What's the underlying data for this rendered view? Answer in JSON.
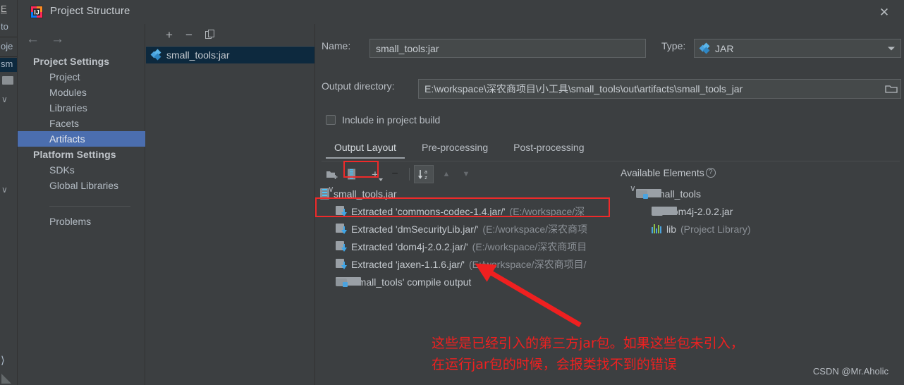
{
  "window": {
    "title": "Project Structure",
    "icon": "intellij-idea-icon",
    "close_label": "✕"
  },
  "background_ide": {
    "menu_fragment": "E",
    "fragments": [
      "to",
      "oje",
      "sm"
    ],
    "selected_fragment": "sm"
  },
  "nav": {
    "back_label": "←",
    "forward_label": "→"
  },
  "sidebar": {
    "groups": [
      {
        "header": "Project Settings",
        "items": [
          {
            "label": "Project",
            "selected": false
          },
          {
            "label": "Modules",
            "selected": false
          },
          {
            "label": "Libraries",
            "selected": false
          },
          {
            "label": "Facets",
            "selected": false
          },
          {
            "label": "Artifacts",
            "selected": true
          }
        ]
      },
      {
        "header": "Platform Settings",
        "items": [
          {
            "label": "SDKs",
            "selected": false
          },
          {
            "label": "Global Libraries",
            "selected": false
          }
        ]
      }
    ],
    "problems_label": "Problems"
  },
  "artifacts_panel": {
    "toolbar": {
      "add_label": "+",
      "remove_label": "−",
      "copy_label": "copy-icon"
    },
    "items": [
      {
        "label": "small_tools:jar",
        "icon": "artifact-jar-icon",
        "selected": true
      }
    ]
  },
  "detail": {
    "name_label": "Name:",
    "name_value": "small_tools:jar",
    "type_label": "Type:",
    "type_value": "JAR",
    "type_icon": "jar-artifact-icon",
    "output_dir_label": "Output directory:",
    "output_dir_value": "E:\\workspace\\深农商项目\\小工具\\small_tools\\out\\artifacts\\small_tools_jar",
    "browse_icon": "folder-browse-icon",
    "include_in_build_label": "Include in project build",
    "include_in_build_checked": false,
    "tabs": [
      {
        "label": "Output Layout",
        "active": true
      },
      {
        "label": "Pre-processing",
        "active": false
      },
      {
        "label": "Post-processing",
        "active": false
      }
    ],
    "layout_toolbar": {
      "create_directory_label": "create-directory-icon",
      "create_archive_label": "create-archive-icon",
      "add_copy_label": "+",
      "remove_label": "−",
      "sort_label": "sort-az-icon",
      "move_up_label": "▲",
      "move_down_label": "▼"
    },
    "available_elements_label": "Available Elements",
    "help_label": "?"
  },
  "output_tree": {
    "root": {
      "label": "small_tools.jar",
      "icon": "jar-icon"
    },
    "children": [
      {
        "prefix": "Extracted 'commons-codec-1.4.jar/'",
        "path": "(E:/workspace/深",
        "icon": "extracted-icon",
        "highlighted": true
      },
      {
        "prefix": "Extracted 'dmSecurityLib.jar/'",
        "path": "(E:/workspace/深农商项",
        "icon": "extracted-icon",
        "highlighted": false
      },
      {
        "prefix": "Extracted 'dom4j-2.0.2.jar/'",
        "path": "(E:/workspace/深农商项目",
        "icon": "extracted-icon",
        "highlighted": false
      },
      {
        "prefix": "Extracted 'jaxen-1.1.6.jar/'",
        "path": "(E:/workspace/深农商项目/",
        "icon": "extracted-icon",
        "highlighted": false
      },
      {
        "prefix": "'small_tools' compile output",
        "path": "",
        "icon": "compile-output-icon",
        "highlighted": false
      }
    ]
  },
  "available_tree": {
    "root": {
      "label": "small_tools",
      "icon": "module-icon",
      "expander": "∨"
    },
    "children": [
      {
        "label": "dom4j-2.0.2.jar",
        "suffix": "",
        "icon": "folder-icon"
      },
      {
        "label": "lib",
        "suffix": "(Project Library)",
        "icon": "library-icon"
      }
    ]
  },
  "annotation": {
    "line1": "这些是已经引入的第三方jar包。如果这些包未引入，",
    "line2": "在运行jar包的时候，会报类找不到的错误",
    "color": "#ef2020"
  },
  "watermark": "CSDN @Mr.Aholic",
  "colors": {
    "dialog_bg": "#3c3f41",
    "selection_blue": "#4b6eaf",
    "list_selection": "#0d293e",
    "input_bg": "#45494a",
    "text": "#c4c9ce",
    "muted_text": "#8b9096",
    "annotation_red": "#ef2020",
    "accent_blue": "#4aa3df"
  }
}
